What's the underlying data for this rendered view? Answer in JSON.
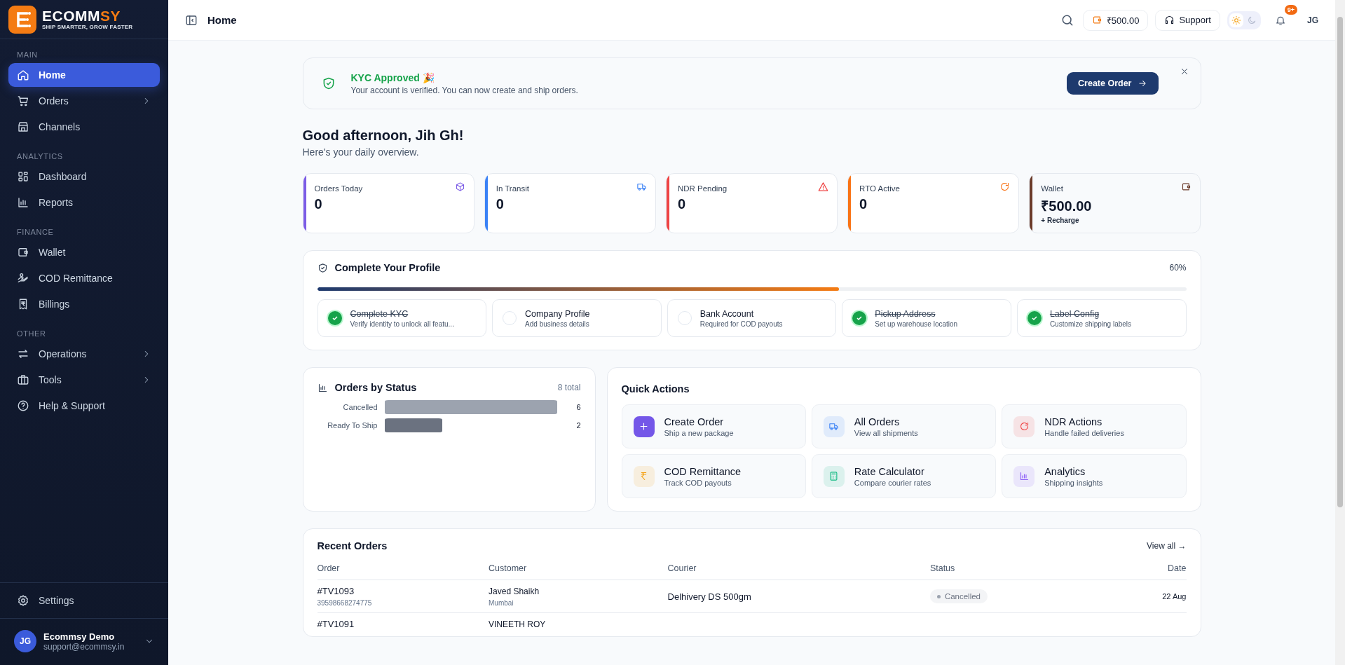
{
  "brand": {
    "name": "ECOMM",
    "name_accent": "SY",
    "tagline": "SHIP SMARTER, GROW FASTER"
  },
  "sidebar": {
    "sections": [
      {
        "title": "MAIN",
        "items": [
          {
            "label": "Home",
            "selected": true,
            "expandable": false
          },
          {
            "label": "Orders",
            "selected": false,
            "expandable": true
          },
          {
            "label": "Channels",
            "selected": false,
            "expandable": false
          }
        ]
      },
      {
        "title": "ANALYTICS",
        "items": [
          {
            "label": "Dashboard",
            "selected": false,
            "expandable": false
          },
          {
            "label": "Reports",
            "selected": false,
            "expandable": false
          }
        ]
      },
      {
        "title": "FINANCE",
        "items": [
          {
            "label": "Wallet",
            "selected": false,
            "expandable": false
          },
          {
            "label": "COD Remittance",
            "selected": false,
            "expandable": false
          },
          {
            "label": "Billings",
            "selected": false,
            "expandable": false
          }
        ]
      },
      {
        "title": "OTHER",
        "items": [
          {
            "label": "Operations",
            "selected": false,
            "expandable": true
          },
          {
            "label": "Tools",
            "selected": false,
            "expandable": true
          },
          {
            "label": "Help & Support",
            "selected": false,
            "expandable": false
          }
        ]
      }
    ],
    "settings": "Settings",
    "user": {
      "initials": "JG",
      "name": "Ecommsy Demo",
      "email": "support@ecommsy.in"
    }
  },
  "topbar": {
    "title": "Home",
    "balance": "₹500.00",
    "support": "Support",
    "dark_mode": false,
    "notifications": "9+",
    "initials": "JG"
  },
  "banner": {
    "title": "KYC Approved 🎉",
    "text": "Your account is verified. You can now create and ship orders.",
    "button": "Create Order"
  },
  "greeting": {
    "title": "Good afternoon, Jih Gh!",
    "subtitle": "Here's your daily overview."
  },
  "stats": [
    {
      "label": "Orders Today",
      "value": "0",
      "color": "#7c5ce6"
    },
    {
      "label": "In Transit",
      "value": "0",
      "color": "#3b82f6"
    },
    {
      "label": "NDR Pending",
      "value": "0",
      "color": "#ef4444"
    },
    {
      "label": "RTO Active",
      "value": "0",
      "color": "#f97316"
    },
    {
      "label": "Wallet",
      "value": "₹500.00",
      "color": "#6b3b2a",
      "link": "+ Recharge"
    }
  ],
  "profile": {
    "title": "Complete Your Profile",
    "percent": "60%",
    "level": 0.6,
    "steps": [
      {
        "title": "Complete KYC",
        "subtitle": "Verify identity to unlock all featu...",
        "done": true
      },
      {
        "title": "Company Profile",
        "subtitle": "Add business details",
        "done": false
      },
      {
        "title": "Bank Account",
        "subtitle": "Required for COD payouts",
        "done": false
      },
      {
        "title": "Pickup Address",
        "subtitle": "Set up warehouse location",
        "done": true
      },
      {
        "title": "Label Config",
        "subtitle": "Customize shipping labels",
        "done": true
      }
    ]
  },
  "orders_by_status": {
    "title": "Orders by Status",
    "total": "8 total",
    "chart_data": {
      "type": "bar",
      "orientation": "horizontal",
      "categories": [
        "Cancelled",
        "Ready To Ship"
      ],
      "values": [
        6,
        2
      ],
      "data_labels": true
    }
  },
  "quick_actions": {
    "title": "Quick Actions",
    "items": [
      {
        "title": "Create Order",
        "subtitle": "Ship a new package",
        "color": "#7457e8"
      },
      {
        "title": "All Orders",
        "subtitle": "View all shipments",
        "color": "#3b82f6"
      },
      {
        "title": "NDR Actions",
        "subtitle": "Handle failed deliveries",
        "color": "#ef4444"
      },
      {
        "title": "COD Remittance",
        "subtitle": "Track COD payouts",
        "color": "#f59e0b"
      },
      {
        "title": "Rate Calculator",
        "subtitle": "Compare courier rates",
        "color": "#10b981"
      },
      {
        "title": "Analytics",
        "subtitle": "Shipping insights",
        "color": "#8b5cf6"
      }
    ]
  },
  "recent_orders": {
    "title": "Recent Orders",
    "view_all": "View all →",
    "columns": [
      "Order",
      "Customer",
      "Courier",
      "Status",
      "Date"
    ],
    "rows": [
      {
        "order": "#TV1093",
        "order_id": "39598668274775",
        "customer": "Javed Shaikh",
        "city": "Mumbai",
        "courier": "Delhivery DS 500gm",
        "status": "Cancelled",
        "date": "22 Aug"
      },
      {
        "order": "#TV1091",
        "customer": "VINEETH ROY"
      }
    ]
  }
}
